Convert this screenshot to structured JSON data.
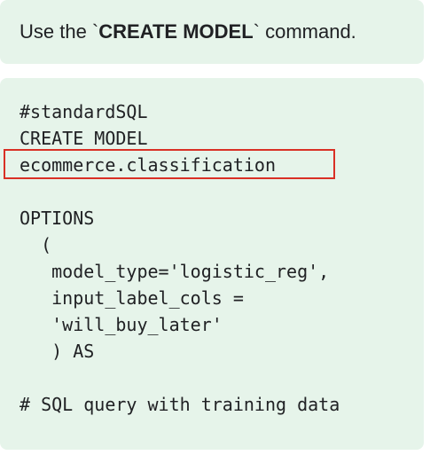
{
  "instruction": {
    "prefix": "Use the `",
    "command": "CREATE MODEL",
    "suffix": "` command."
  },
  "code": {
    "lines": [
      "#standardSQL",
      "CREATE MODEL",
      "ecommerce.classification",
      "",
      "OPTIONS",
      "  (",
      "   model_type='logistic_reg',",
      "   input_label_cols =",
      "   'will_buy_later'",
      "   ) AS",
      "",
      "# SQL query with training data"
    ],
    "highlighted_line": "ecommerce.classification"
  },
  "colors": {
    "card_background": "#e6f4ea",
    "highlight_border": "#d93025",
    "text": "#202124"
  }
}
